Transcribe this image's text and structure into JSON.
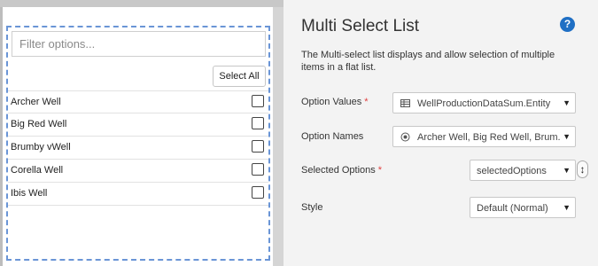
{
  "widget": {
    "filter_placeholder": "Filter options...",
    "select_all_label": "Select All",
    "options": [
      {
        "label": "Archer Well",
        "checked": false
      },
      {
        "label": "Big Red Well",
        "checked": false
      },
      {
        "label": "Brumby vWell",
        "checked": false
      },
      {
        "label": "Corella Well",
        "checked": false
      },
      {
        "label": "Ibis Well",
        "checked": false
      }
    ]
  },
  "properties": {
    "title": "Multi Select List",
    "help_icon": "?",
    "description": "The Multi-select list displays and allow selection of multiple items in a flat list.",
    "option_values": {
      "label": "Option Values",
      "required_mark": "*",
      "value": "WellProductionDataSum.Entity",
      "icon": "table-icon"
    },
    "option_names": {
      "label": "Option Names",
      "value": "Archer Well, Big Red Well, Brum...",
      "icon": "radio-icon"
    },
    "selected_options": {
      "label": "Selected Options",
      "required_mark": "*",
      "value": "selectedOptions"
    },
    "style": {
      "label": "Style",
      "value": "Default (Normal)"
    }
  },
  "colors": {
    "accent_blue": "#1f6fc4",
    "required_red": "#e04040",
    "widget_border": "#6a95d6",
    "panel_bg": "#f3f3f3"
  }
}
